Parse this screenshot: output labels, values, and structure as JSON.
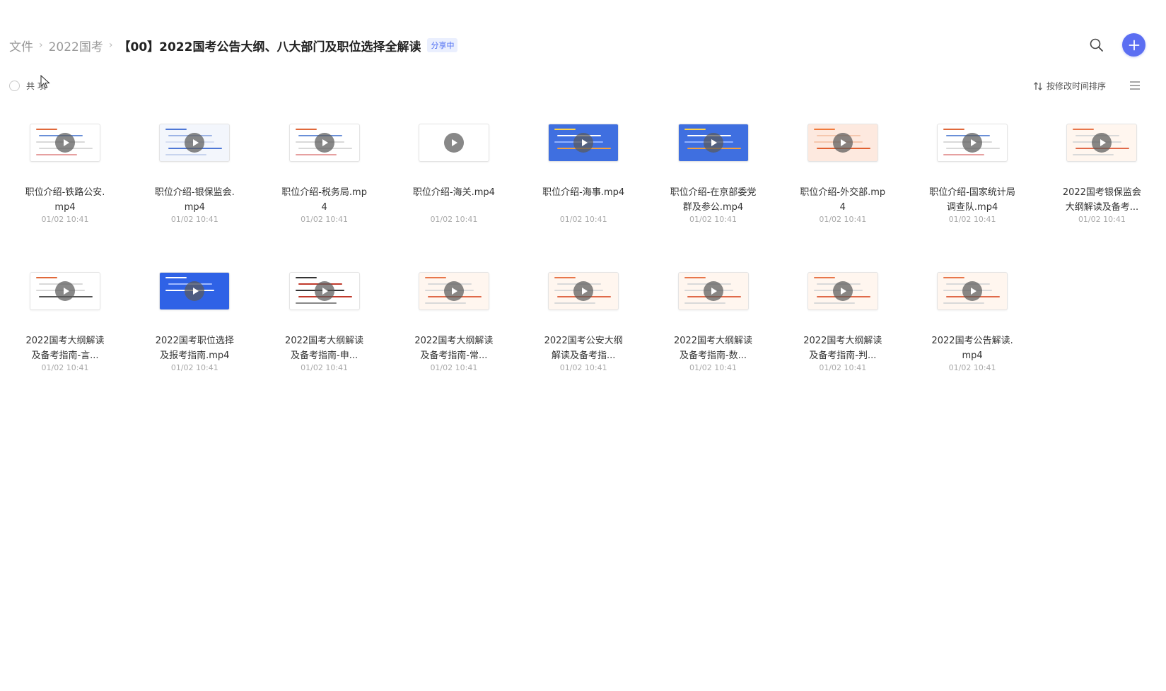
{
  "breadcrumb": {
    "root": "文件",
    "parent": "2022国考",
    "current": "【00】2022国考公告大纲、八大部门及职位选择全解读",
    "share_badge": "分享中"
  },
  "toolbar": {
    "count_text": "共 项",
    "sort_label": "按修改时间排序"
  },
  "icons": {
    "search": "search-icon",
    "add": "plus-icon",
    "sort": "sort-icon",
    "view": "list-view-icon",
    "play": "play-icon"
  },
  "colors": {
    "accent": "#5b6ef2",
    "badge_bg": "#eaeffe",
    "badge_text": "#4e6ef2"
  },
  "files": [
    {
      "name": "职位介绍-铁路公安.mp4",
      "time": "01/02 10:41",
      "thumb": "doc"
    },
    {
      "name": "职位介绍-银保监会.mp4",
      "time": "01/02 10:41",
      "thumb": "chart"
    },
    {
      "name": "职位介绍-税务局.mp4",
      "time": "01/02 10:41",
      "thumb": "doc"
    },
    {
      "name": "职位介绍-海关.mp4",
      "time": "01/02 10:41",
      "thumb": "blank"
    },
    {
      "name": "职位介绍-海事.mp4",
      "time": "01/02 10:41",
      "thumb": "blue"
    },
    {
      "name": "职位介绍-在京部委党群及参公.mp4",
      "time": "01/02 10:41",
      "thumb": "blue"
    },
    {
      "name": "职位介绍-外交部.mp4",
      "time": "01/02 10:41",
      "thumb": "peach"
    },
    {
      "name": "职位介绍-国家统计局调查队.mp4",
      "time": "01/02 10:41",
      "thumb": "doc"
    },
    {
      "name": "2022国考银保监会大纲解读及备考...",
      "time": "01/02 10:41",
      "thumb": "orange"
    },
    {
      "name": "2022国考大纲解读及备考指南-言...",
      "time": "01/02 10:41",
      "thumb": "dark"
    },
    {
      "name": "2022国考职位选择及报考指南.mp4",
      "time": "01/02 10:41",
      "thumb": "blue2"
    },
    {
      "name": "2022国考大纲解读及备考指南-申...",
      "time": "01/02 10:41",
      "thumb": "red"
    },
    {
      "name": "2022国考大纲解读及备考指南-常...",
      "time": "01/02 10:41",
      "thumb": "orange"
    },
    {
      "name": "2022国考公安大纲解读及备考指...",
      "time": "01/02 10:41",
      "thumb": "orange"
    },
    {
      "name": "2022国考大纲解读及备考指南-数...",
      "time": "01/02 10:41",
      "thumb": "orange"
    },
    {
      "name": "2022国考大纲解读及备考指南-判...",
      "time": "01/02 10:41",
      "thumb": "orange"
    },
    {
      "name": "2022国考公告解读.mp4",
      "time": "01/02 10:41",
      "thumb": "orange"
    }
  ]
}
